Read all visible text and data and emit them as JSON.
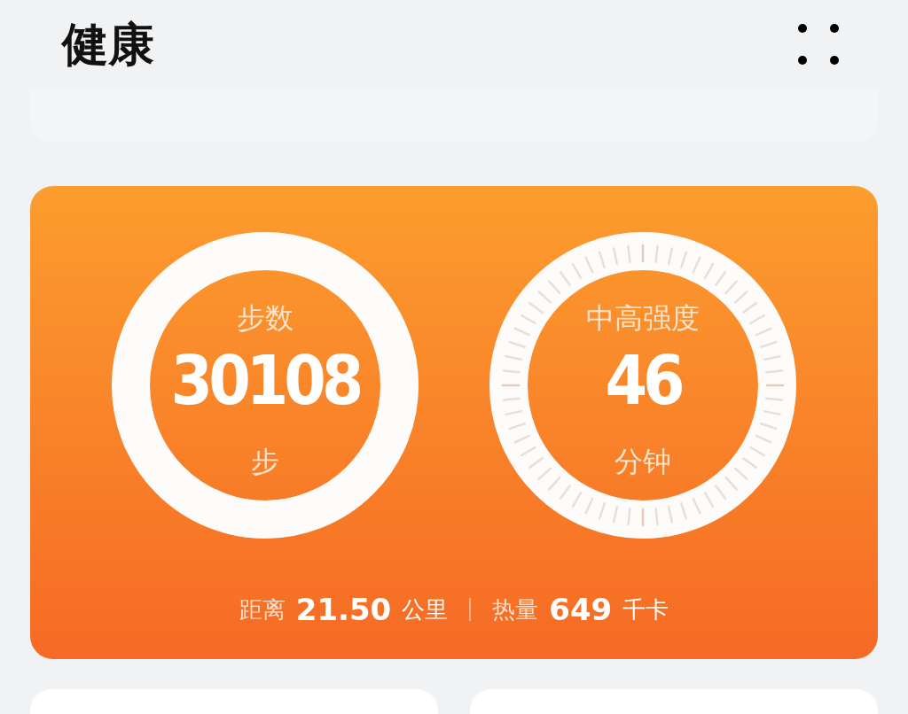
{
  "header": {
    "title": "健康"
  },
  "activity": {
    "rings": [
      {
        "kind": "plain",
        "label": "步数",
        "value": "30108",
        "unit": "步",
        "level": 1
      },
      {
        "kind": "ticks",
        "label": "中高强度",
        "value": "46",
        "unit": "分钟",
        "level": 1
      }
    ],
    "summary": [
      {
        "label": "距离",
        "value": "21.50",
        "unit": "公里"
      },
      {
        "label": "热量",
        "value": "649",
        "unit": "千卡"
      }
    ]
  }
}
